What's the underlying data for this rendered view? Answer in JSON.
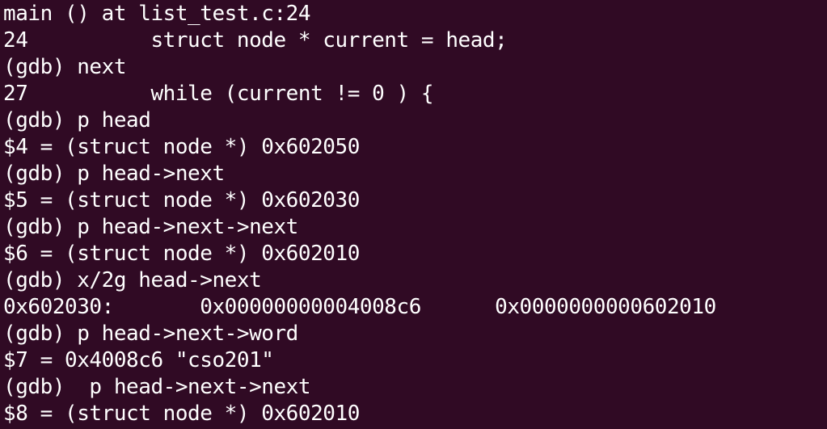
{
  "terminal": {
    "background": "#300a24",
    "foreground": "#ffffff",
    "lines": [
      "main () at list_test.c:24",
      "24          struct node * current = head;",
      "(gdb) next",
      "27          while (current != 0 ) {",
      "(gdb) p head",
      "$4 = (struct node *) 0x602050",
      "(gdb) p head->next",
      "$5 = (struct node *) 0x602030",
      "(gdb) p head->next->next",
      "$6 = (struct node *) 0x602010",
      "(gdb) x/2g head->next",
      "0x602030:       0x00000000004008c6      0x0000000000602010",
      "(gdb) p head->next->word",
      "$7 = 0x4008c6 \"cso201\"",
      "(gdb)  p head->next->next",
      "$8 = (struct node *) 0x602010"
    ]
  }
}
